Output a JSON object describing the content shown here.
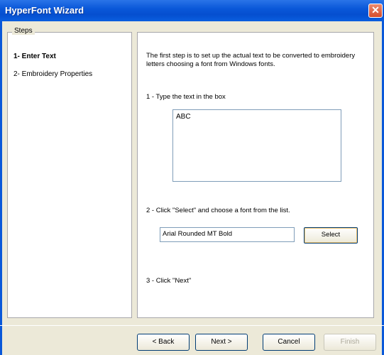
{
  "window": {
    "title": "HyperFont Wizard",
    "close_glyph": "✕"
  },
  "steps": {
    "legend": "Steps",
    "items": [
      "1- Enter Text",
      "2- Embroidery Properties"
    ]
  },
  "content": {
    "intro": "The first step is to set up the actual text to be converted to embroidery letters choosing a font from Windows fonts.",
    "instruction1": "1 - Type the text in the box",
    "text_value": "ABC",
    "instruction2": "2 - Click \"Select\" and choose a font from the list.",
    "font_value": "Arial Rounded MT Bold",
    "select_label": "Select",
    "instruction3": "3 - Click \"Next\""
  },
  "buttons": {
    "back": "< Back",
    "next": "Next >",
    "cancel": "Cancel",
    "finish": "Finish"
  }
}
